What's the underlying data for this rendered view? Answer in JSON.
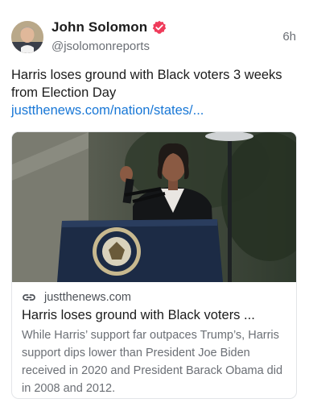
{
  "post": {
    "author": {
      "display_name": "John Solomon",
      "handle": "@jsolomonreports",
      "verified": true,
      "avatar": "avatar-photo"
    },
    "timestamp": "6h",
    "text": "Harris loses ground with Black voters 3 weeks from Election Day ",
    "link_text": "justthenews.com/nation/states/..."
  },
  "link_preview": {
    "image": "photo-podium-speaker",
    "domain": "justthenews.com",
    "title": "Harris loses ground with Black voters ...",
    "description": "While Harris’ support far outpaces Trump’s, Harris support dips lower than President Joe Biden received in 2020 and President Barack Obama did in 2008 and 2012."
  },
  "icons": {
    "verified": "verified-badge-icon",
    "link": "link-icon"
  },
  "colors": {
    "link": "#1877d6",
    "verified_badge": "#ef3b5a",
    "secondary_text": "#6b6f75"
  }
}
